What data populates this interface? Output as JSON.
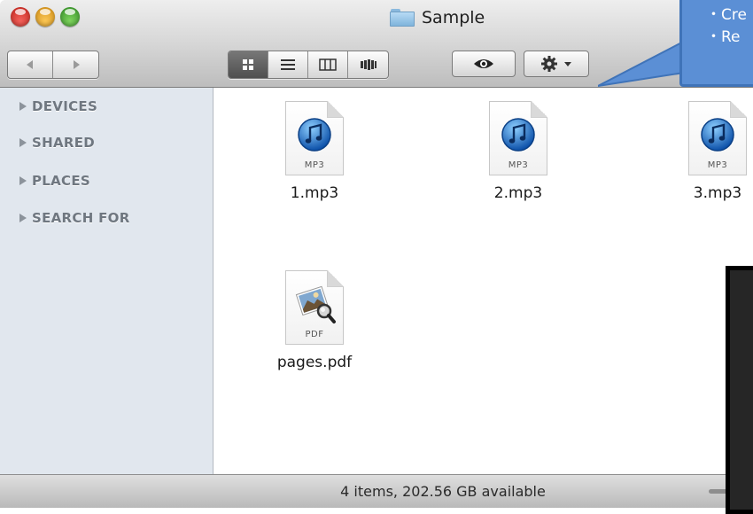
{
  "window": {
    "title": "Sample"
  },
  "toolbar": {
    "nav": [
      {
        "icon": "back-arrow-icon"
      },
      {
        "icon": "forward-arrow-icon"
      }
    ],
    "views": [
      {
        "icon": "icon-view-icon",
        "active": true
      },
      {
        "icon": "list-view-icon",
        "active": false
      },
      {
        "icon": "column-view-icon",
        "active": false
      },
      {
        "icon": "cover-flow-icon",
        "active": false
      }
    ],
    "quicklook_icon": "eye-icon",
    "action_icon": "gear-icon"
  },
  "sidebar": {
    "items": [
      {
        "label": "DEVICES"
      },
      {
        "label": "SHARED"
      },
      {
        "label": "PLACES"
      },
      {
        "label": "SEARCH FOR"
      }
    ]
  },
  "files": [
    {
      "name": "1.mp3",
      "kind": "MP3",
      "icon": "itunes-note-icon"
    },
    {
      "name": "2.mp3",
      "kind": "MP3",
      "icon": "itunes-note-icon"
    },
    {
      "name": "3.mp3",
      "kind": "MP3",
      "icon": "itunes-note-icon"
    },
    {
      "name": "pages.pdf",
      "kind": "PDF",
      "icon": "preview-pdf-icon"
    }
  ],
  "status": {
    "text": "4 items, 202.56 GB available"
  },
  "callout": {
    "lines": [
      "・Cre",
      "・Re"
    ],
    "color": "#5b8fd5"
  },
  "colors": {
    "sidebar_bg": "#e1e7ee",
    "sidebar_text": "#6f7780",
    "active_segment": "#5a5a5a"
  }
}
